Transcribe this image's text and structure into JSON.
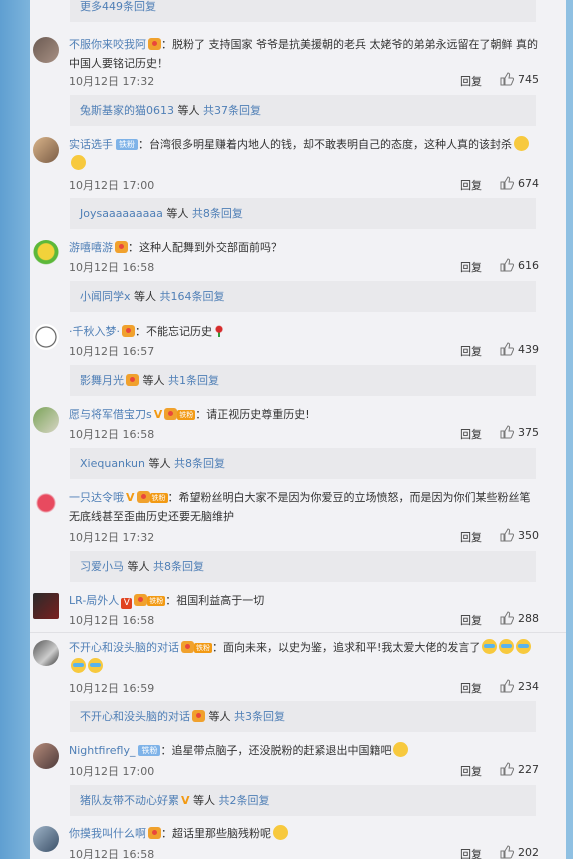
{
  "top_more": {
    "label": "更多449条回复"
  },
  "comments": [
    {
      "name": "不服你来咬我阿",
      "badges": [
        "heart"
      ],
      "text": "：脱粉了 支持国家 爷爷是抗美援朝的老兵 太姥爷的弟弟永远留在了朝鲜 真的中国人要铭记历史！",
      "time": "10月12日 17:32",
      "reply": "回复",
      "likes": "745",
      "sub": {
        "name": "兔斯基家的猫0613",
        "suffix": " 等人 ",
        "count": "共37条回复"
      }
    },
    {
      "name": "实话选手",
      "badges": [
        "vip"
      ],
      "vip": "铁粉",
      "text": "：台湾很多明星赚着内地人的钱，却不敢表明自己的态度，这种人真的该封杀",
      "emoji": [
        "smile",
        "smile"
      ],
      "time": "10月12日 17:00",
      "reply": "回复",
      "likes": "674",
      "sub": {
        "name": "Joysaaaaaaaaa",
        "suffix": " 等人 ",
        "count": "共8条回复"
      }
    },
    {
      "name": "游嘻嘻游",
      "badges": [
        "heart"
      ],
      "text": "：这种人配舞到外交部面前吗？",
      "time": "10月12日 16:58",
      "reply": "回复",
      "likes": "616",
      "sub": {
        "name": "小闻同学x",
        "suffix": " 等人 ",
        "count": "共164条回复"
      }
    },
    {
      "name": "·千秋入梦·",
      "badges": [
        "heart"
      ],
      "text": "：不能忘记历史",
      "time": "10月12日 16:57",
      "reply": "回复",
      "likes": "439",
      "sub": {
        "name": "影舞月光",
        "suffix": " 等人 ",
        "count": "共1条回复"
      }
    },
    {
      "name": "愿与将军借宝刀s",
      "badges": [
        "v",
        "heartlv"
      ],
      "lv": "铁粉",
      "text": "：请正视历史尊重历史!",
      "time": "10月12日 16:58",
      "reply": "回复",
      "likes": "375",
      "sub": {
        "name": "Xiequankun",
        "suffix": " 等人 ",
        "count": "共8条回复"
      }
    },
    {
      "name": "一只达令哦",
      "badges": [
        "v",
        "heartlv"
      ],
      "lv": "铁粉",
      "text": "：希望粉丝明白大家不是因为你爱豆的立场愤怒，而是因为你们某些粉丝笔无底线甚至歪曲历史还要无脑维护",
      "time": "10月12日 17:32",
      "reply": "回复",
      "likes": "350",
      "sub": {
        "name": "习爱小马",
        "suffix": " 等人 ",
        "count": "共8条回复"
      }
    },
    {
      "name": "LR-局外人",
      "badges": [
        "vred",
        "heartlv"
      ],
      "lv": "铁粉",
      "text": "：祖国利益高于一切",
      "time": "10月12日 16:58",
      "reply": "回复",
      "likes": "288"
    },
    {
      "name": "不开心和没头脑的对话",
      "badges": [
        "heartlv"
      ],
      "lv": "铁粉",
      "text": "：面向未来，以史为鉴，追求和平!我太爱大佬的发言了",
      "time": "10月12日 16:59",
      "reply": "回复",
      "likes": "234",
      "sub": {
        "name": "不开心和没头脑的对话",
        "suffix": " 等人 ",
        "count": "共3条回复"
      }
    },
    {
      "name": "Nightfirefly_",
      "badges": [
        "vip"
      ],
      "vip": "铁粉",
      "text": "：追星带点脑子，还没脱粉的赶紧退出中国籍吧",
      "time": "10月12日 17:00",
      "reply": "回复",
      "likes": "227",
      "sub": {
        "name": "猪队友带不动心好累",
        "suffix": " 等人 ",
        "count": "共2条回复"
      }
    },
    {
      "name": "你摸我叫什么啊",
      "badges": [
        "heart"
      ],
      "text": "：超话里那些脑残粉呢",
      "time": "10月12日 16:58",
      "reply": "回复",
      "likes": "202"
    }
  ],
  "icons": {
    "like": "thumb-up-icon"
  },
  "colors": {
    "link": "#4f7fb6",
    "panel": "#f2f2f5",
    "reply_bar": "#e9e9ec"
  }
}
